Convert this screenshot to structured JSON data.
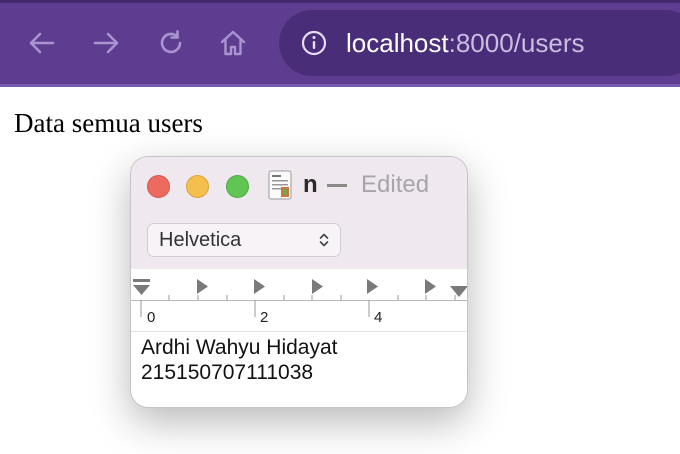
{
  "browser": {
    "nav": {
      "back_icon": "arrow-left-icon",
      "forward_icon": "arrow-right-icon",
      "reload_icon": "reload-icon",
      "home_icon": "home-icon"
    },
    "address": {
      "host": "localhost",
      "rest": ":8000/users"
    },
    "colors": {
      "toolbar": "#5e3d91",
      "urlbar": "#4a2d78"
    }
  },
  "page": {
    "heading": "Data semua users"
  },
  "textedit": {
    "title": "n",
    "status": "Edited",
    "font": "Helvetica",
    "ruler_labels": [
      "0",
      "2",
      "4"
    ],
    "lines": [
      "Ardhi Wahyu Hidayat",
      "215150707111038"
    ],
    "traffic_colors": {
      "close": "#ed6a5e",
      "minimize": "#f5bf4f",
      "zoom": "#61c554"
    }
  }
}
